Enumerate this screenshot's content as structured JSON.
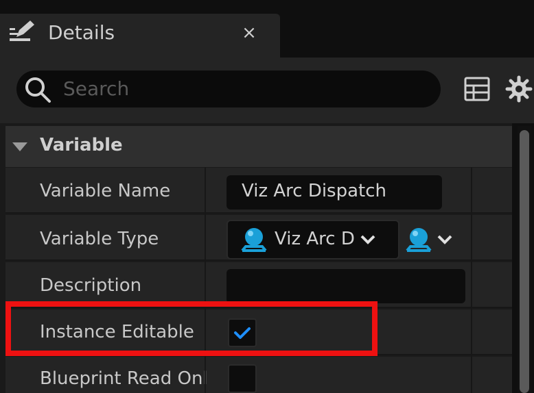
{
  "tab": {
    "title": "Details",
    "close_glyph": "×"
  },
  "search": {
    "placeholder": "Search",
    "value": ""
  },
  "toolbar": {
    "icons": [
      "grid-view-icon",
      "gear-icon"
    ]
  },
  "category": {
    "label": "Variable",
    "expanded": true
  },
  "properties": {
    "variable_name": {
      "label": "Variable Name",
      "value": "Viz Arc Dispatch"
    },
    "variable_type": {
      "label": "Variable Type",
      "value": "Viz Arc D",
      "icon": "object-pin-icon",
      "color": "#1aa0d8"
    },
    "description": {
      "label": "Description",
      "value": ""
    },
    "instance_editable": {
      "label": "Instance Editable",
      "checked": true,
      "highlighted": true
    },
    "blueprint_read_only": {
      "label": "Blueprint Read Onl",
      "checked": false
    }
  },
  "colors": {
    "accent": "#1aa0d8",
    "checkmark": "#1e8fff",
    "highlight": "#ee1111"
  }
}
